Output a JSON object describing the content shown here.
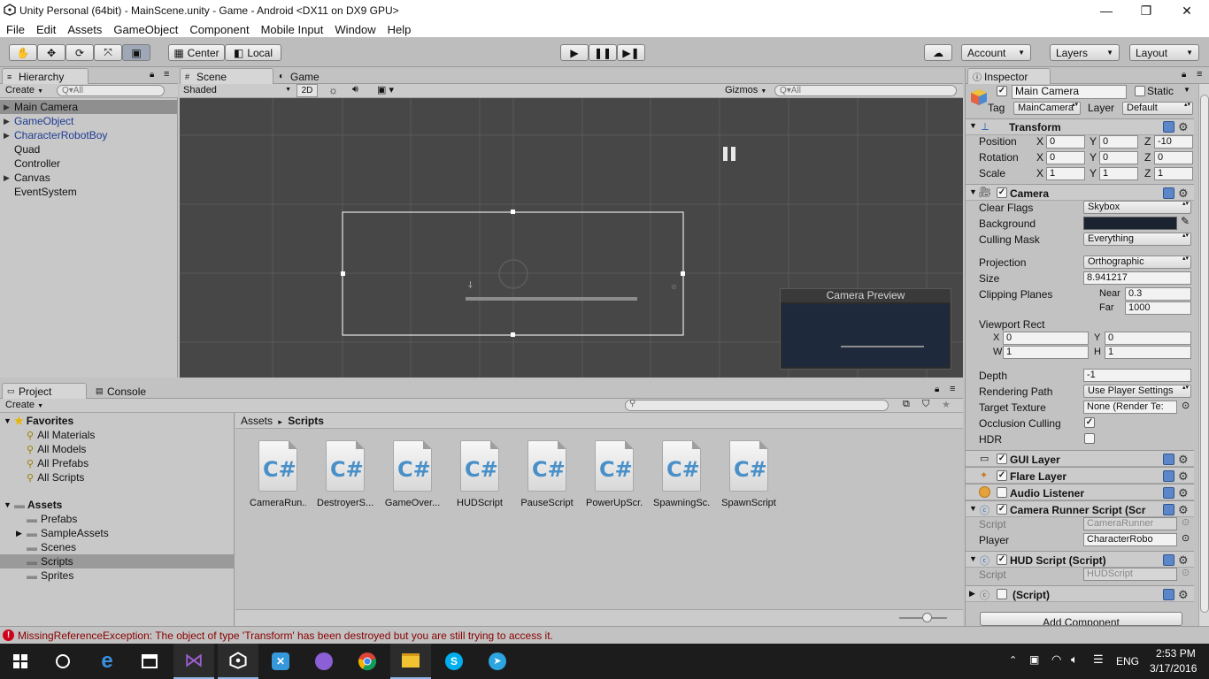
{
  "window": {
    "title": "Unity Personal (64bit) - MainScene.unity - Game - Android <DX11 on DX9 GPU>",
    "minimize": "—",
    "maximize": "❐",
    "close": "✕"
  },
  "menu": [
    "File",
    "Edit",
    "Assets",
    "GameObject",
    "Component",
    "Mobile Input",
    "Window",
    "Help"
  ],
  "toolbar": {
    "pivot": "Center",
    "space": "Local",
    "account": "Account",
    "layers": "Layers",
    "layout": "Layout"
  },
  "hierarchy": {
    "tab": "Hierarchy",
    "create": "Create",
    "search_placeholder": "Q▾All",
    "items": [
      {
        "label": "Main Camera"
      },
      {
        "label": "GameObject"
      },
      {
        "label": "CharacterRobotBoy"
      },
      {
        "label": "Quad"
      },
      {
        "label": "Controller"
      },
      {
        "label": "Canvas"
      },
      {
        "label": "EventSystem"
      }
    ]
  },
  "scene": {
    "tab_scene": "Scene",
    "tab_game": "Game",
    "shading": "Shaded",
    "mode2d": "2D",
    "gizmos": "Gizmos",
    "search_placeholder": "Q▾All",
    "preview_title": "Camera Preview"
  },
  "project": {
    "tab_project": "Project",
    "tab_console": "Console",
    "create": "Create",
    "favorites_label": "Favorites",
    "favorites": [
      "All Materials",
      "All Models",
      "All Prefabs",
      "All Scripts"
    ],
    "assets_label": "Assets",
    "folders": [
      "Prefabs",
      "SampleAssets",
      "Scenes",
      "Scripts",
      "Sprites"
    ],
    "breadcrumb_root": "Assets",
    "breadcrumb_sep": "▸",
    "breadcrumb_current": "Scripts",
    "scripts": [
      "CameraRun...",
      "DestroyerS...",
      "GameOver...",
      "HUDScript",
      "PauseScript",
      "PowerUpScr...",
      "SpawningSc...",
      "SpawnScript"
    ],
    "script_glyph": "C#"
  },
  "inspector": {
    "tab": "Inspector",
    "object_name": "Main Camera",
    "static_label": "Static",
    "tag_label": "Tag",
    "tag_value": "MainCamera",
    "layer_label": "Layer",
    "layer_value": "Default",
    "transform": {
      "title": "Transform",
      "position_label": "Position",
      "rotation_label": "Rotation",
      "scale_label": "Scale",
      "axis_x": "X",
      "axis_y": "Y",
      "axis_z": "Z",
      "position": [
        "0",
        "0",
        "-10"
      ],
      "rotation": [
        "0",
        "0",
        "0"
      ],
      "scale": [
        "1",
        "1",
        "1"
      ]
    },
    "camera": {
      "title": "Camera",
      "clear_flags_label": "Clear Flags",
      "clear_flags": "Skybox",
      "background_label": "Background",
      "culling_mask_label": "Culling Mask",
      "culling_mask": "Everything",
      "projection_label": "Projection",
      "projection": "Orthographic",
      "size_label": "Size",
      "size": "8.941217",
      "clipping_label": "Clipping Planes",
      "near_label": "Near",
      "near": "0.3",
      "far_label": "Far",
      "far": "1000",
      "viewport_label": "Viewport Rect",
      "vx_label": "X",
      "vx": "0",
      "vy_label": "Y",
      "vy": "0",
      "vw_label": "W",
      "vw": "1",
      "vh_label": "H",
      "vh": "1",
      "depth_label": "Depth",
      "depth": "-1",
      "rendering_path_label": "Rendering Path",
      "rendering_path": "Use Player Settings",
      "target_texture_label": "Target Texture",
      "target_texture": "None (Render Te:",
      "occlusion_label": "Occlusion Culling",
      "hdr_label": "HDR"
    },
    "gui_layer": "GUI Layer",
    "flare_layer": "Flare Layer",
    "audio_listener": "Audio Listener",
    "camera_runner": {
      "title": "Camera Runner Script (Scr",
      "script_label": "Script",
      "script_value": "CameraRunner",
      "player_label": "Player",
      "player_value": "CharacterRobo"
    },
    "hud_script": {
      "title": "HUD Script (Script)",
      "script_label": "Script",
      "script_value": "HUDScript"
    },
    "missing_script": "(Script)",
    "add_component": "Add Component"
  },
  "console_error": "MissingReferenceException: The object of type 'Transform' has been destroyed but you are still trying to access it.",
  "taskbar": {
    "language": "ENG",
    "time": "2:53 PM",
    "date": "3/17/2016"
  },
  "colors": {
    "scene_bg": "#474747",
    "camera_bg": "#1e2a3c",
    "error_red": "#d0021b",
    "link_blue": "#1f3b94"
  }
}
